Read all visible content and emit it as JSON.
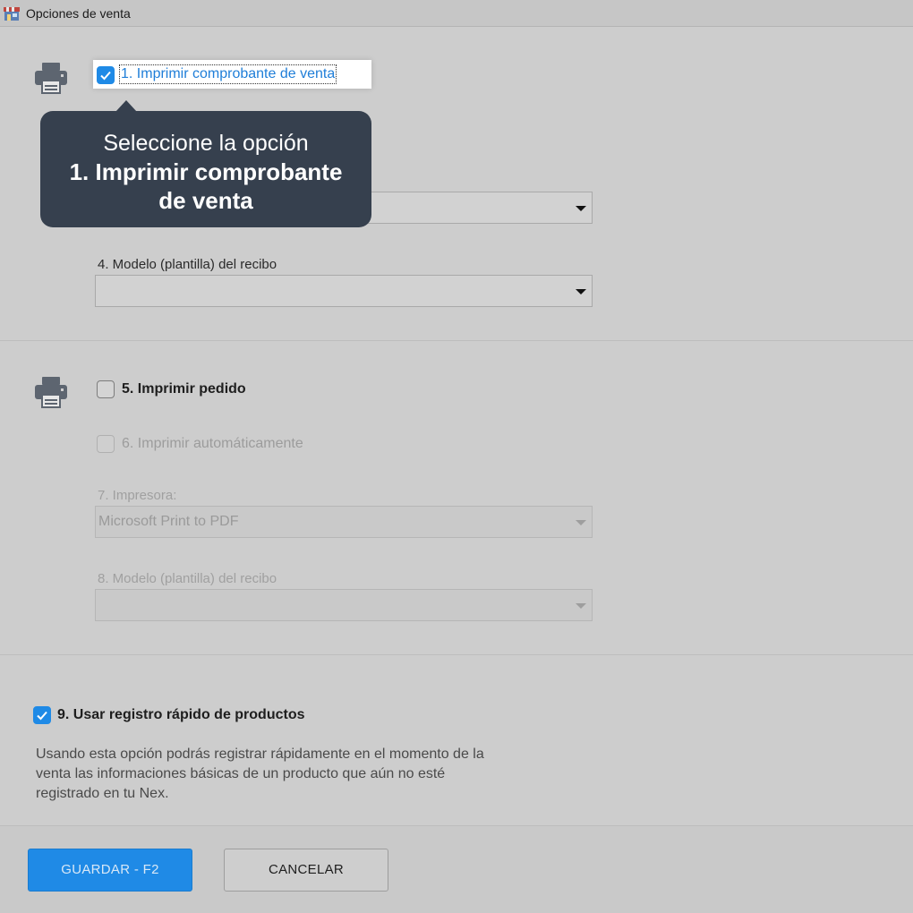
{
  "window": {
    "title": "Opciones de venta"
  },
  "section1": {
    "checkbox_label": "1. Imprimir comprobante de venta",
    "checked": true,
    "field4_label": "4. Modelo (plantilla) del recibo",
    "field4_value": ""
  },
  "tooltip": {
    "line1": "Seleccione la opción",
    "line2": "1. Imprimir comprobante de venta"
  },
  "section2": {
    "checkbox5_label": "5. Imprimir pedido",
    "checkbox6_label": "6. Imprimir automáticamente",
    "field7_label": "7. Impresora:",
    "field7_value": "Microsoft Print to PDF",
    "field8_label": "8. Modelo (plantilla) del recibo",
    "field8_value": ""
  },
  "section3": {
    "checkbox9_label": "9. Usar registro rápido de productos",
    "description": "Usando esta opción podrás registrar rápidamente en el momento de la venta las informaciones básicas de un producto que aún no esté registrado en tu Nex."
  },
  "footer": {
    "save_label": "GUARDAR - F2",
    "cancel_label": "CANCELAR"
  },
  "colors": {
    "accent": "#1f8ae6",
    "tooltip_bg": "#36404e",
    "background": "#cdcdcd"
  }
}
